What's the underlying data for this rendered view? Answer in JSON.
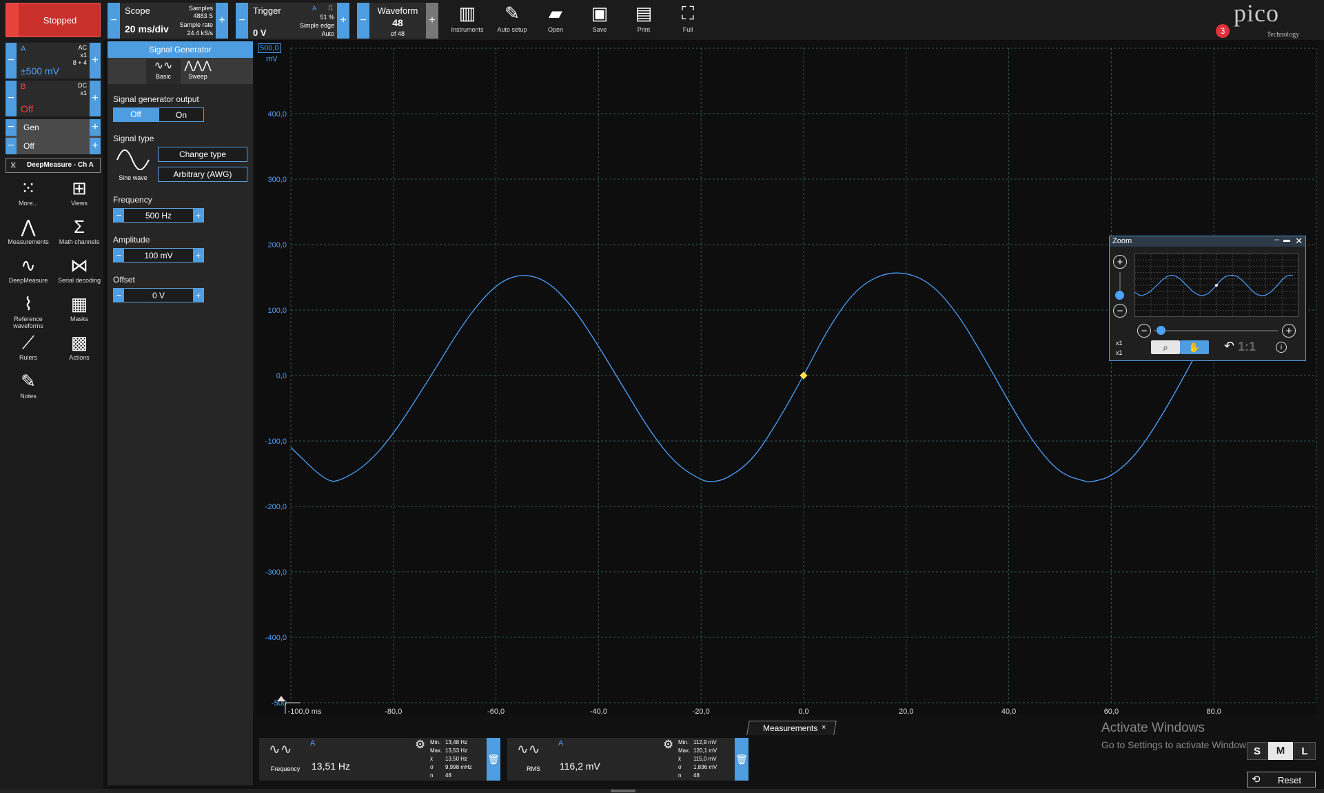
{
  "status": "Stopped",
  "scope": {
    "title": "Scope",
    "timebase": "20 ms/div",
    "samples_label": "Samples",
    "samples": "4883 S",
    "rate_label": "Sample rate",
    "rate": "24.4 kS/s"
  },
  "trigger": {
    "title": "Trigger",
    "level": "0 V",
    "channel": "A",
    "pre": "51 %",
    "type": "Simple edge",
    "mode": "Auto"
  },
  "waveform": {
    "title": "Waveform",
    "current": "48",
    "of": "of 48"
  },
  "tools": [
    {
      "label": "Instruments",
      "icon": "instruments-icon",
      "glyph": "▥"
    },
    {
      "label": "Auto setup",
      "icon": "wand-icon",
      "glyph": "✎"
    },
    {
      "label": "Open",
      "icon": "folder-icon",
      "glyph": "▰"
    },
    {
      "label": "Save",
      "icon": "save-icon",
      "glyph": "▣"
    },
    {
      "label": "Print",
      "icon": "print-icon",
      "glyph": "▤"
    },
    {
      "label": "Full",
      "icon": "fullscreen-icon",
      "glyph": "⛶"
    }
  ],
  "brand": {
    "logo": "pico",
    "sub": "Technology",
    "badge": "3"
  },
  "channels": [
    {
      "name": "A",
      "coupling": "AC",
      "probe": "x1",
      "ratio": "8 + 4",
      "range": "±500 mV",
      "color": "#4da3ff"
    },
    {
      "name": "B",
      "coupling": "DC",
      "probe": "x1",
      "ratio": "",
      "range": "Off",
      "color": "#ff3b3b"
    }
  ],
  "gen": {
    "label": "Gen",
    "state": "Off"
  },
  "deepmeasure_button": "DeepMeasure - Ch A",
  "sidebar_tiles": [
    {
      "label": "More...",
      "icon": "grid-dots-icon",
      "glyph": "⁙"
    },
    {
      "label": "Views",
      "icon": "views-icon",
      "glyph": "⊞"
    },
    {
      "label": "Measurements",
      "icon": "measurements-icon",
      "glyph": "⋀"
    },
    {
      "label": "Math channels",
      "icon": "sigma-icon",
      "glyph": "Σ"
    },
    {
      "label": "DeepMeasure",
      "icon": "deepmeasure-icon",
      "glyph": "∿"
    },
    {
      "label": "Serial decoding",
      "icon": "serial-icon",
      "glyph": "⋈"
    },
    {
      "label": "Reference waveforms",
      "icon": "reference-icon",
      "glyph": "⌇"
    },
    {
      "label": "Masks",
      "icon": "masks-icon",
      "glyph": "▦"
    },
    {
      "label": "Rulers",
      "icon": "ruler-icon",
      "glyph": "⟋"
    },
    {
      "label": "Actions",
      "icon": "clapper-icon",
      "glyph": "▩"
    },
    {
      "label": "Notes",
      "icon": "notes-icon",
      "glyph": "✎"
    }
  ],
  "siggen": {
    "title": "Signal Generator",
    "tabs": [
      "Basic",
      "Sweep"
    ],
    "output_label": "Signal generator output",
    "output_options": [
      "Off",
      "On"
    ],
    "signal_type_label": "Signal type",
    "wave_name": "Sine wave",
    "change_type": "Change type",
    "awg": "Arbitrary (AWG)",
    "frequency_label": "Frequency",
    "frequency": "500 Hz",
    "amplitude_label": "Amplitude",
    "amplitude": "100 mV",
    "offset_label": "Offset",
    "offset": "0 V"
  },
  "plot": {
    "y_unit": "mV",
    "y_top_box": "500,0",
    "y_ticks": [
      "400,0",
      "300,0",
      "200,0",
      "100,0",
      "0,0",
      "-100,0",
      "-200,0",
      "-300,0",
      "-400,0",
      "-500"
    ],
    "x_ticks": [
      "-100,0 ms",
      "-80,0",
      "-60,0",
      "-40,0",
      "-20,0",
      "0,0",
      "20,0",
      "40,0",
      "60,0",
      "80,0"
    ],
    "trace_color": "#4da3ff"
  },
  "chart_data": {
    "type": "line",
    "x_unit": "ms",
    "y_unit": "mV",
    "xlim": [
      -100,
      100
    ],
    "ylim": [
      -500,
      500
    ],
    "series": [
      {
        "x": [
          -100,
          -93,
          -90,
          -85,
          -80,
          -73,
          -66,
          -60,
          -55,
          -50,
          -45,
          -40,
          -35,
          -30,
          -25,
          -20,
          -18,
          -15,
          -10,
          -5,
          0,
          5,
          10,
          15,
          20,
          25,
          30,
          35,
          40,
          45,
          50,
          55,
          56,
          60,
          65,
          70,
          75,
          80,
          85,
          90,
          93
        ],
        "y": [
          -110,
          -163,
          -160,
          -135,
          -90,
          -5,
          85,
          140,
          156,
          145,
          105,
          45,
          -20,
          -85,
          -135,
          -160,
          -163,
          -158,
          -130,
          -70,
          0,
          75,
          130,
          155,
          158,
          140,
          95,
          30,
          -40,
          -105,
          -150,
          -162,
          -163,
          -155,
          -120,
          -60,
          10,
          85,
          140,
          160,
          155
        ]
      }
    ]
  },
  "zoom": {
    "title": "Zoom",
    "x1a": "x1",
    "x1b": "x1",
    "ratio": "1:1"
  },
  "measurements": {
    "tab": "Measurements",
    "items": [
      {
        "channel": "A",
        "name": "Frequency",
        "value": "13,51 Hz",
        "min_l": "Min.",
        "min": "13,48 Hz",
        "max_l": "Max.",
        "max": "13,53 Hz",
        "avg_l": "x̄",
        "avg": "13,50 Hz",
        "sd_l": "σ",
        "sd": "9,998 mHz",
        "n_l": "n",
        "n": "48"
      },
      {
        "channel": "A",
        "name": "RMS",
        "value": "116,2 mV",
        "min_l": "Min.",
        "min": "112,9 mV",
        "max_l": "Max.",
        "max": "120,1 mV",
        "avg_l": "x̄",
        "avg": "115,0 mV",
        "sd_l": "σ",
        "sd": "1,836 mV",
        "n_l": "n",
        "n": "48"
      }
    ]
  },
  "activate": {
    "title": "Activate Windows",
    "sub": "Go to Settings to activate Windows."
  },
  "size_buttons": [
    "S",
    "M",
    "L"
  ],
  "reset": "Reset"
}
